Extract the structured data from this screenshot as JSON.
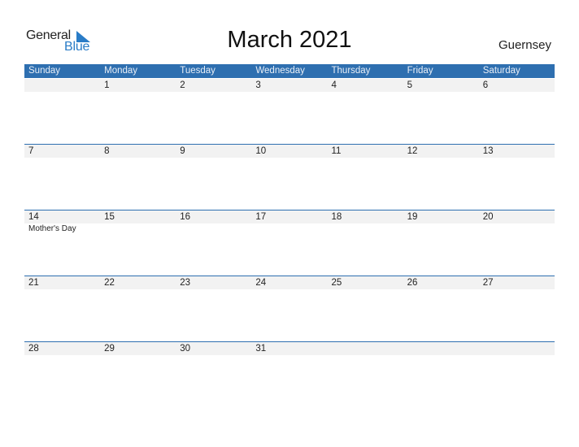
{
  "logo": {
    "word1": "General",
    "word2": "Blue"
  },
  "title": "March 2021",
  "country": "Guernsey",
  "colors": {
    "accent": "#2e6fb0",
    "date_band": "#f2f2f2",
    "logo_blue": "#2a7cc7"
  },
  "weekdays": [
    "Sunday",
    "Monday",
    "Tuesday",
    "Wednesday",
    "Thursday",
    "Friday",
    "Saturday"
  ],
  "weeks": [
    {
      "days": [
        "",
        "1",
        "2",
        "3",
        "4",
        "5",
        "6"
      ],
      "events": [
        "",
        "",
        "",
        "",
        "",
        "",
        ""
      ]
    },
    {
      "days": [
        "7",
        "8",
        "9",
        "10",
        "11",
        "12",
        "13"
      ],
      "events": [
        "",
        "",
        "",
        "",
        "",
        "",
        ""
      ]
    },
    {
      "days": [
        "14",
        "15",
        "16",
        "17",
        "18",
        "19",
        "20"
      ],
      "events": [
        "Mother's Day",
        "",
        "",
        "",
        "",
        "",
        ""
      ]
    },
    {
      "days": [
        "21",
        "22",
        "23",
        "24",
        "25",
        "26",
        "27"
      ],
      "events": [
        "",
        "",
        "",
        "",
        "",
        "",
        ""
      ]
    },
    {
      "days": [
        "28",
        "29",
        "30",
        "31",
        "",
        "",
        ""
      ],
      "events": [
        "",
        "",
        "",
        "",
        "",
        "",
        ""
      ]
    }
  ]
}
